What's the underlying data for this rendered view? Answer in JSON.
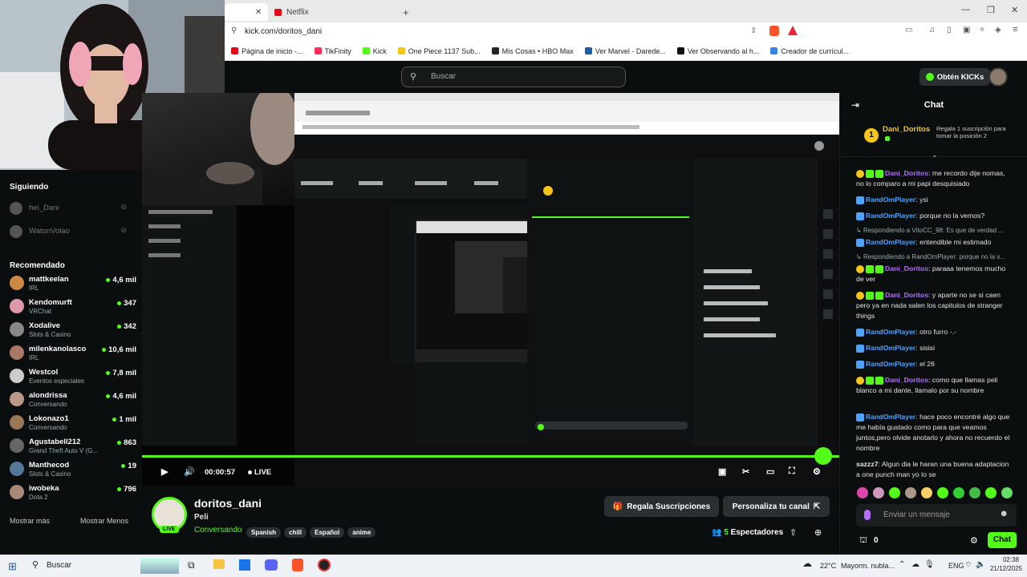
{
  "browser": {
    "tabs": [
      {
        "label": "Netflix"
      }
    ],
    "url": "kick.com/doritos_dani",
    "bookmarks": [
      {
        "label": "Página de inicio -...",
        "color": "#e50914"
      },
      {
        "label": "TikFinity",
        "color": "#ff2d55"
      },
      {
        "label": "Kick",
        "color": "#53fc18"
      },
      {
        "label": "One Piece 1137 Sub...",
        "color": "#f5c518"
      },
      {
        "label": "Mis Cosas • HBO Max",
        "color": "#222222"
      },
      {
        "label": "Ver Marvel - Darede...",
        "color": "#1a5fb4"
      },
      {
        "label": "Ver Observando al h...",
        "color": "#111111"
      },
      {
        "label": "Creador de currícul...",
        "color": "#3584e4"
      }
    ]
  },
  "topbar": {
    "search_placeholder": "Buscar",
    "kicks_label": "Obtén KICKs"
  },
  "sidebar": {
    "following_title": "Siguiendo",
    "following": [
      {
        "name": "hei_Dani"
      },
      {
        "name": "WatonVolao"
      }
    ],
    "recommended_title": "Recomendado",
    "recommended": [
      {
        "name": "mattkeelan",
        "category": "IRL",
        "viewers": "4,6 mil",
        "color": "#c84"
      },
      {
        "name": "Kendomurft",
        "category": "VRChat",
        "viewers": "347",
        "color": "#d9a"
      },
      {
        "name": "Xodalive",
        "category": "Slots & Casino",
        "viewers": "342",
        "color": "#888"
      },
      {
        "name": "milenkanolasco",
        "category": "IRL",
        "viewers": "10,6 mil",
        "color": "#a76"
      },
      {
        "name": "Westcol",
        "category": "Eventos especiales",
        "viewers": "7,8 mil",
        "color": "#ccc"
      },
      {
        "name": "alondrissa",
        "category": "Conversando",
        "viewers": "4,6 mil",
        "color": "#b98"
      },
      {
        "name": "Lokonazo1",
        "category": "Conversando",
        "viewers": "1 mil",
        "color": "#975"
      },
      {
        "name": "Agustabell212",
        "category": "Grand Theft Auto V (G...",
        "viewers": "863",
        "color": "#666"
      },
      {
        "name": "Manthecod",
        "category": "Slots & Casino",
        "viewers": "19",
        "color": "#579"
      },
      {
        "name": "iwobeka",
        "category": "Dota 2",
        "viewers": "796",
        "color": "#a87"
      }
    ],
    "show_more": "Mostrar más",
    "show_less": "Mostrar Menos"
  },
  "player": {
    "time": "00:00:57",
    "live": "LIVE"
  },
  "stream": {
    "channel": "doritos_dani",
    "title": "Peli",
    "category": "Conversando",
    "tags": [
      "Spanish",
      "chill",
      "Español",
      "anime"
    ],
    "live_badge": "LIVE",
    "gift_button": "Regala Suscripciones",
    "customize_button": "Personaliza tu canal",
    "viewers_count": "5",
    "viewers_label": "Espectadores"
  },
  "chat": {
    "title": "Chat",
    "pinned_user": "Dani_Doritos",
    "pinned_rank": "1",
    "pinned_text": "Regala 1 suscripción para tomar la posición 2",
    "messages": [
      {
        "type": "msg",
        "user": "Dani_Doritos",
        "color": "#b66dff",
        "text": "me recordo dije nomas, no lo comparo a mi papi desquisiado",
        "badges": "host"
      },
      {
        "type": "msg",
        "user": "RandOmPlayer",
        "color": "#4da3ff",
        "text": "ysi",
        "badges": "sub"
      },
      {
        "type": "msg",
        "user": "RandOmPlayer",
        "color": "#4da3ff",
        "text": "porque no la vemos?",
        "badges": "sub"
      },
      {
        "type": "reply",
        "text": "Respondiendo a VitoCC_98: Es que de verdad ..."
      },
      {
        "type": "msg",
        "user": "RandOmPlayer",
        "color": "#4da3ff",
        "text": "entendible mi estimado",
        "badges": "sub"
      },
      {
        "type": "reply",
        "text": "Respondiendo a RandOmPlayer: porque no la v..."
      },
      {
        "type": "msg",
        "user": "Dani_Doritos",
        "color": "#b66dff",
        "text": "paraaa tenemos mucho de ver",
        "badges": "host"
      },
      {
        "type": "msg",
        "user": "Dani_Doritos",
        "color": "#b66dff",
        "text": "y aparte no se si caen pero ya en nada salen los capitulos de stranger things",
        "badges": "host"
      },
      {
        "type": "msg",
        "user": "RandOmPlayer",
        "color": "#4da3ff",
        "text": "otro furro -.-",
        "badges": "sub"
      },
      {
        "type": "msg",
        "user": "RandOmPlayer",
        "color": "#4da3ff",
        "text": "sisisi",
        "badges": "sub"
      },
      {
        "type": "msg",
        "user": "RandOmPlayer",
        "color": "#4da3ff",
        "text": "el 26",
        "badges": "sub"
      },
      {
        "type": "msg",
        "user": "Dani_Doritos",
        "color": "#b66dff",
        "text": "como que llamas peli blanco a mi dante, llamalo por su nombre",
        "badges": "host"
      },
      {
        "type": "msg",
        "user": "RandOmPlayer",
        "color": "#4da3ff",
        "text": "hace poco encontré algo que me había gustado como para que veamos juntos,pero olvide anotarlo y ahora no recuerdo el nombre",
        "badges": "sub"
      },
      {
        "type": "msg",
        "user": "sazzz7",
        "color": "#e4e4e4",
        "text": "Algun dia le haran una buena adaptacion a one punch man yo lo se",
        "badges": "none"
      }
    ],
    "input_placeholder": "Enviar un mensaje",
    "kicks_count": "0",
    "send_button": "Chat"
  },
  "taskbar": {
    "search": "Buscar",
    "weather": "22°C",
    "weather_desc": "Mayorm. nubla...",
    "lang": "ENG",
    "time": "02:38",
    "date": "21/12/2025"
  },
  "colors": {
    "accent": "#53fc18",
    "background": "#0b0e0f",
    "panel": "#2a2f31"
  }
}
